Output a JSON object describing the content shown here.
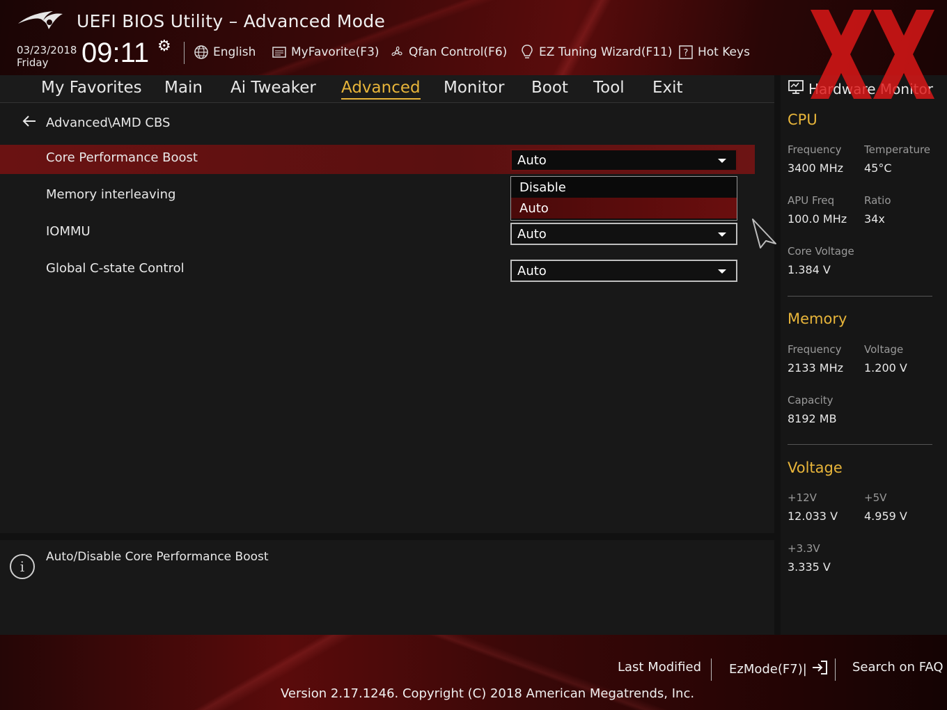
{
  "window": {
    "title": "UEFI BIOS Utility – Advanced Mode",
    "date": "03/23/2018",
    "day": "Friday",
    "time": "09:11"
  },
  "toolbar": {
    "language": "English",
    "myfavorite": "MyFavorite(F3)",
    "qfan": "Qfan Control(F6)",
    "ez_tuning": "EZ Tuning Wizard(F11)",
    "hotkeys": "Hot Keys"
  },
  "nav": {
    "tabs": [
      {
        "label": "My Favorites"
      },
      {
        "label": "Main"
      },
      {
        "label": "Ai Tweaker"
      },
      {
        "label": "Advanced"
      },
      {
        "label": "Monitor"
      },
      {
        "label": "Boot"
      },
      {
        "label": "Tool"
      },
      {
        "label": "Exit"
      }
    ],
    "active": "Advanced"
  },
  "main": {
    "breadcrumb": "Advanced\\AMD CBS",
    "settings": [
      {
        "label": "Core Performance Boost",
        "value": "Auto"
      },
      {
        "label": "Memory interleaving",
        "value": ""
      },
      {
        "label": "IOMMU",
        "value": "Auto"
      },
      {
        "label": "Global C-state Control",
        "value": "Auto"
      }
    ],
    "dropdown": {
      "options": [
        "Disable",
        "Auto"
      ],
      "selected": "Auto"
    }
  },
  "info": {
    "text": "Auto/Disable Core Performance Boost"
  },
  "hardware_monitor": {
    "title": "Hardware Monitor",
    "cpu": {
      "heading": "CPU",
      "frequency_label": "Frequency",
      "frequency": "3400 MHz",
      "temperature_label": "Temperature",
      "temperature": "45°C",
      "apu_label": "APU Freq",
      "apu": "100.0 MHz",
      "ratio_label": "Ratio",
      "ratio": "34x",
      "core_voltage_label": "Core Voltage",
      "core_voltage": "1.384 V"
    },
    "memory": {
      "heading": "Memory",
      "frequency_label": "Frequency",
      "frequency": "2133 MHz",
      "voltage_label": "Voltage",
      "voltage": "1.200 V",
      "capacity_label": "Capacity",
      "capacity": "8192 MB"
    },
    "voltage": {
      "heading": "Voltage",
      "v12_label": "+12V",
      "v12": "12.033 V",
      "v5_label": "+5V",
      "v5": "4.959 V",
      "v33_label": "+3.3V",
      "v33": "3.335 V"
    }
  },
  "footer": {
    "last_modified": "Last Modified",
    "ezmode": "EzMode(F7)|",
    "search_faq": "Search on FAQ",
    "version": "Version 2.17.1246. Copyright (C) 2018 American Megatrends, Inc."
  },
  "colors": {
    "accent": "#e8b53a",
    "highlight": "#6a1212",
    "background": "#181818"
  }
}
